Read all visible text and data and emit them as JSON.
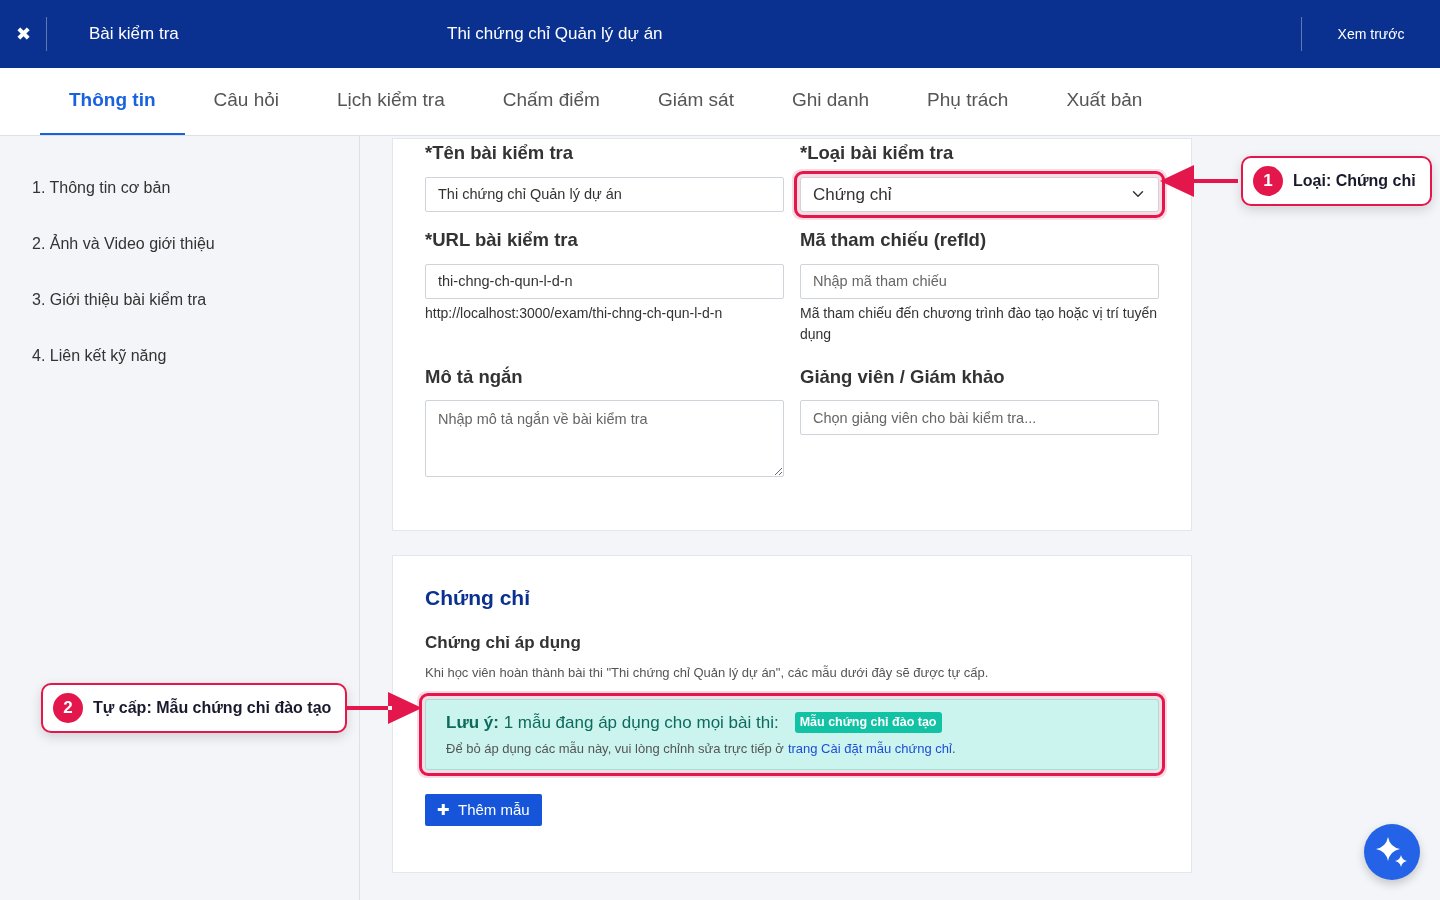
{
  "header": {
    "close": "✖",
    "section": "Bài kiểm tra",
    "title": "Thi chứng chỉ Quản lý dự án",
    "preview": "Xem trước"
  },
  "tabs": [
    {
      "label": "Thông tin",
      "selected": true
    },
    {
      "label": "Câu hỏi",
      "selected": false
    },
    {
      "label": "Lịch kiểm tra",
      "selected": false
    },
    {
      "label": "Chấm điểm",
      "selected": false
    },
    {
      "label": "Giám sát",
      "selected": false
    },
    {
      "label": "Ghi danh",
      "selected": false
    },
    {
      "label": "Phụ trách",
      "selected": false
    },
    {
      "label": "Xuất bản",
      "selected": false
    }
  ],
  "sidebar": {
    "items": [
      "1. Thông tin cơ bản",
      "2. Ảnh và Video giới thiệu",
      "3. Giới thiệu bài kiểm tra",
      "4. Liên kết kỹ năng"
    ]
  },
  "form": {
    "fields": [
      {
        "kind": "input",
        "label": "*Tên bài kiểm tra",
        "value": "Thi chứng chỉ Quản lý dự án",
        "highlighted": false
      },
      {
        "kind": "select",
        "label": "*Loại bài kiểm tra",
        "value": "Chứng chỉ",
        "highlighted": true
      },
      {
        "kind": "input",
        "label": "*URL bài kiểm tra",
        "value": "thi-chng-ch-qun-l-d-n",
        "help": "http://localhost:3000/exam/thi-chng-ch-qun-l-d-n",
        "highlighted": false
      },
      {
        "kind": "input",
        "label": "Mã tham chiếu (refId)",
        "placeholder": "Nhập mã tham chiếu",
        "help": "Mã tham chiếu đến chương trình đào tạo hoặc vị trí tuyển dụng",
        "highlighted": false
      },
      {
        "kind": "textarea",
        "label": "Mô tả ngắn",
        "placeholder": "Nhập mô tả ngắn về bài kiểm tra",
        "highlighted": false
      },
      {
        "kind": "input",
        "label": "Giảng viên / Giám khảo",
        "placeholder": "Chọn giảng viên cho bài kiểm tra...",
        "highlighted": false
      }
    ]
  },
  "certificate": {
    "title": "Chứng chỉ",
    "subtitle": "Chứng chỉ áp dụng",
    "description": "Khi học viên hoàn thành bài thi \"Thi chứng chỉ Quản lý dự án\", các mẫu dưới đây sẽ được tự cấp.",
    "notice": {
      "text": "**Lưu ý:** 1 mẫu đang áp dụng cho mọi bài thi:",
      "badge": "Mẫu chứng chỉ đào tạo",
      "hint": "Để bỏ áp dụng các mẫu này, vui lòng chỉnh sửa trực tiếp ở",
      "link": "trang Cài đặt mẫu chứng chỉ",
      "end": ".",
      "highlighted": true
    },
    "add_button": {
      "icon": "✚",
      "label": "Thêm mẫu"
    }
  },
  "annotations": [
    {
      "number": "1",
      "text": "Loại: Chứng chỉ",
      "kind": "right"
    },
    {
      "number": "2",
      "text": "Tự cấp: Mẫu chứng chỉ đào tạo",
      "kind": "left"
    }
  ]
}
